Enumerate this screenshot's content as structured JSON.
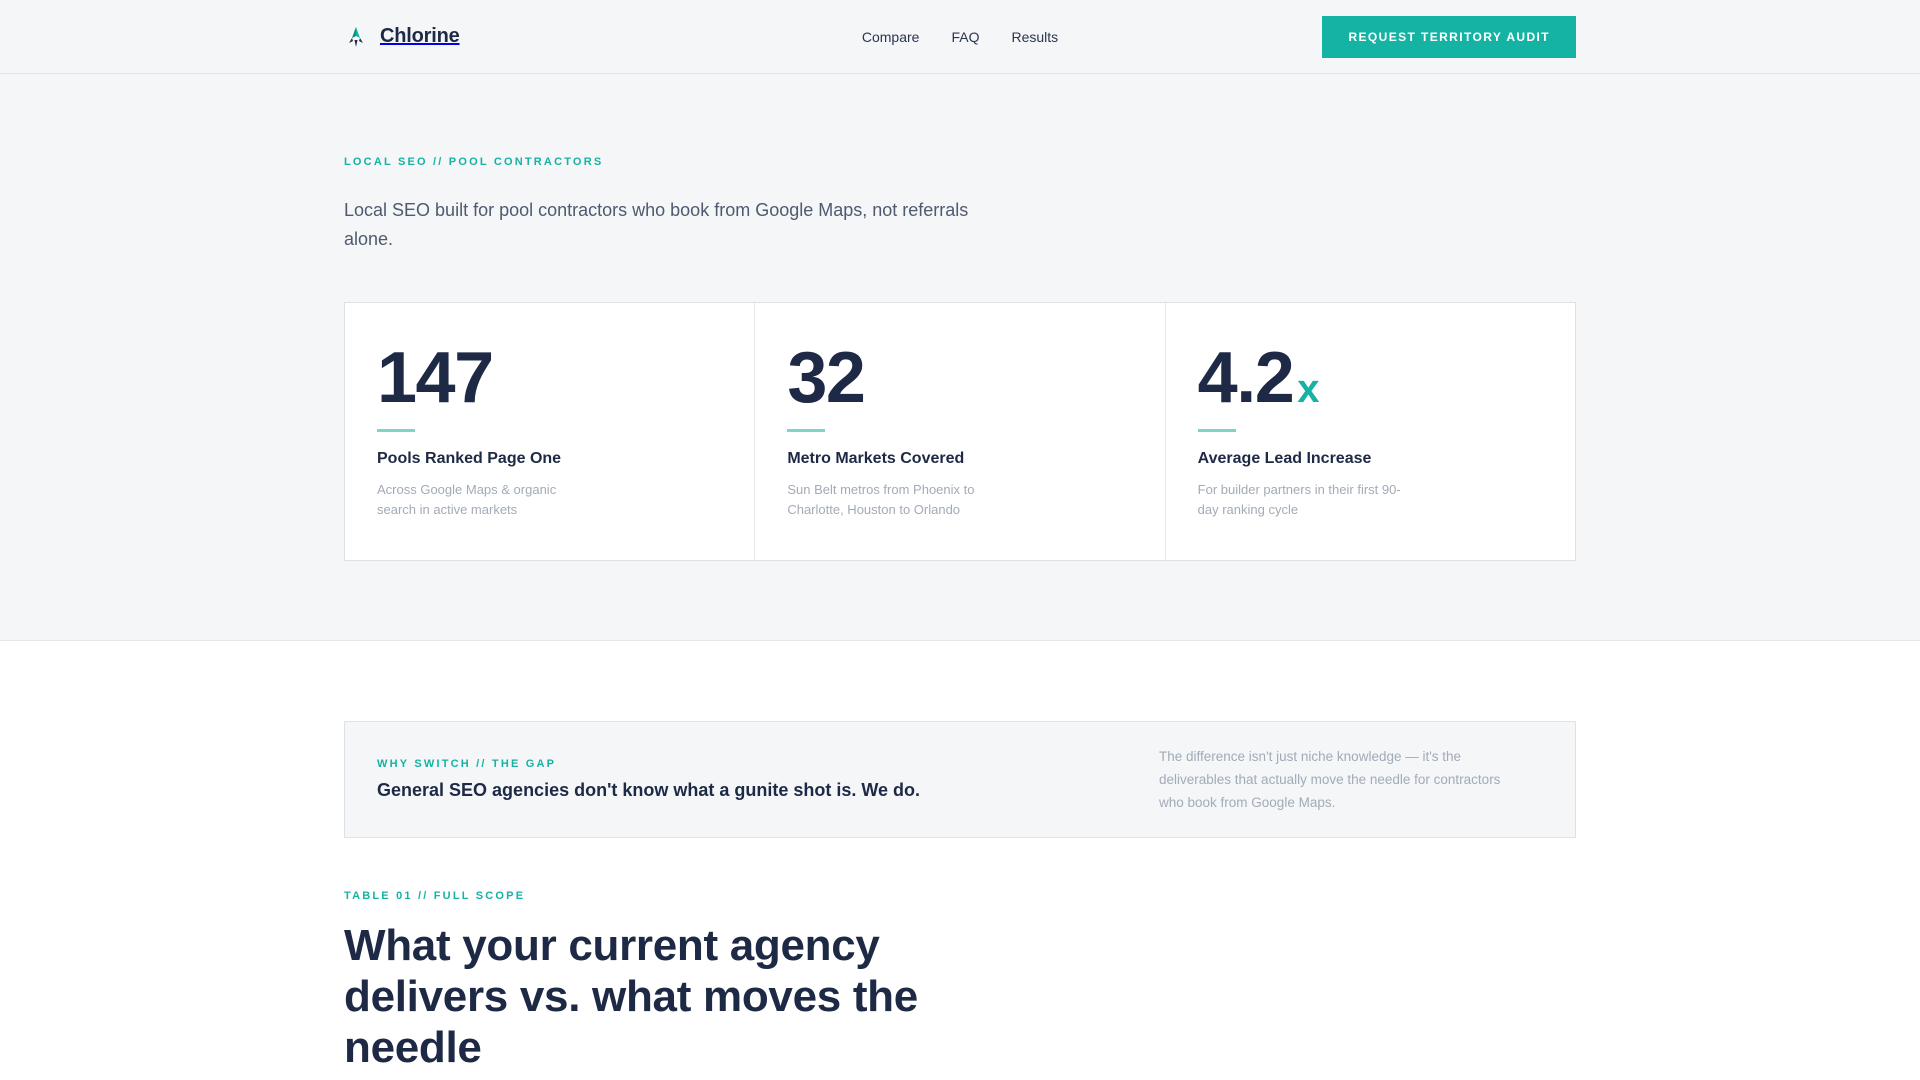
{
  "header": {
    "brand_name": "Chlorine",
    "brand_icon": "rocket-icon",
    "nav": [
      "Compare",
      "FAQ",
      "Results"
    ],
    "cta_label": "REQUEST TERRITORY AUDIT"
  },
  "hero": {
    "eyebrow": "LOCAL SEO // POOL CONTRACTORS",
    "lede": "Local SEO built for pool contractors who book from Google Maps, not referrals alone.",
    "stats": [
      {
        "value": "147",
        "suffix": "",
        "label": "Pools Ranked Page One",
        "desc": "Across Google Maps & organic search in active markets"
      },
      {
        "value": "32",
        "suffix": "",
        "label": "Metro Markets Covered",
        "desc": "Sun Belt metros from Phoenix to Charlotte, Houston to Orlando"
      },
      {
        "value": "4.2",
        "suffix": "x",
        "label": "Average Lead Increase",
        "desc": "For builder partners in their first 90-day ranking cycle"
      }
    ]
  },
  "gap": {
    "eyebrow": "WHY SWITCH // THE GAP",
    "title": "General SEO agencies don't know what a gunite shot is. We do.",
    "body": "The difference isn't just niche knowledge — it's the deliverables that actually move the needle for contractors who book from Google Maps."
  },
  "scope": {
    "eyebrow": "TABLE 01 // FULL SCOPE",
    "title": "What your current agency delivers vs. what moves the needle"
  },
  "colors": {
    "accent": "#14b3a3",
    "navy": "#1e2a45",
    "muted": "#a2abb7",
    "background": "#f4f6f8"
  }
}
